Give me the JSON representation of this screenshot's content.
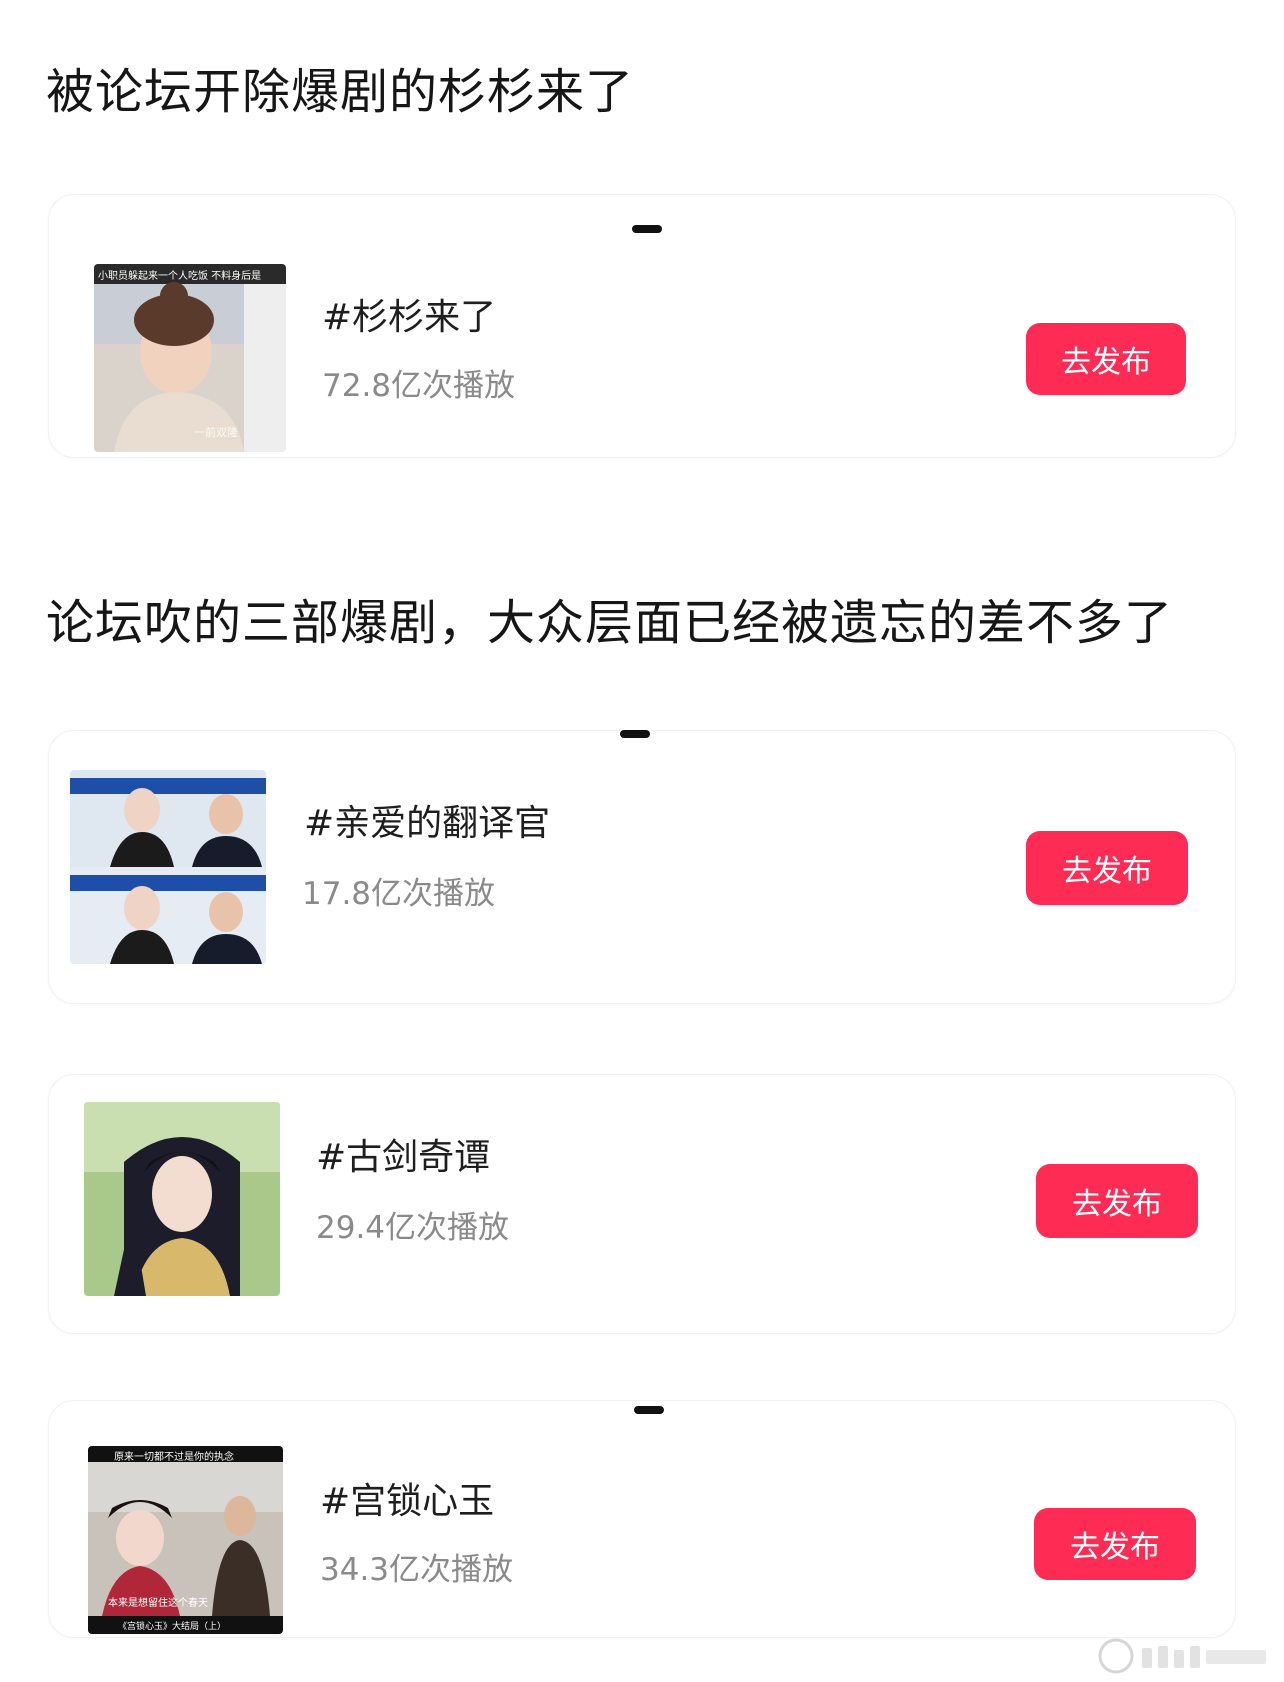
{
  "sections": [
    {
      "heading": "被论坛开除爆剧的杉杉来了"
    },
    {
      "heading": "论坛吹的三部爆剧，大众层面已经被遗忘的差不多了"
    }
  ],
  "cards": [
    {
      "tag": "#杉杉来了",
      "plays": "72.8亿次播放",
      "button": "去发布",
      "thumb_caption_top": "小职员躲起来一个人吃饭 不料身后是",
      "thumb_caption_bottom": "一前双隆"
    },
    {
      "tag": "#亲爱的翻译官",
      "plays": "17.8亿次播放",
      "button": "去发布"
    },
    {
      "tag": "#古剑奇谭",
      "plays": "29.4亿次播放",
      "button": "去发布"
    },
    {
      "tag": "#宫锁心玉",
      "plays": "34.3亿次播放",
      "button": "去发布",
      "thumb_caption_top": "原来一切都不过是你的执念",
      "thumb_caption_bottom": "《宫锁心玉》大结局（上）",
      "thumb_subtitle": "本来是想留住这个春天"
    }
  ],
  "colors": {
    "accent": "#fe2c55",
    "plays_text": "#8a8a8a",
    "heading_text": "#161616"
  }
}
